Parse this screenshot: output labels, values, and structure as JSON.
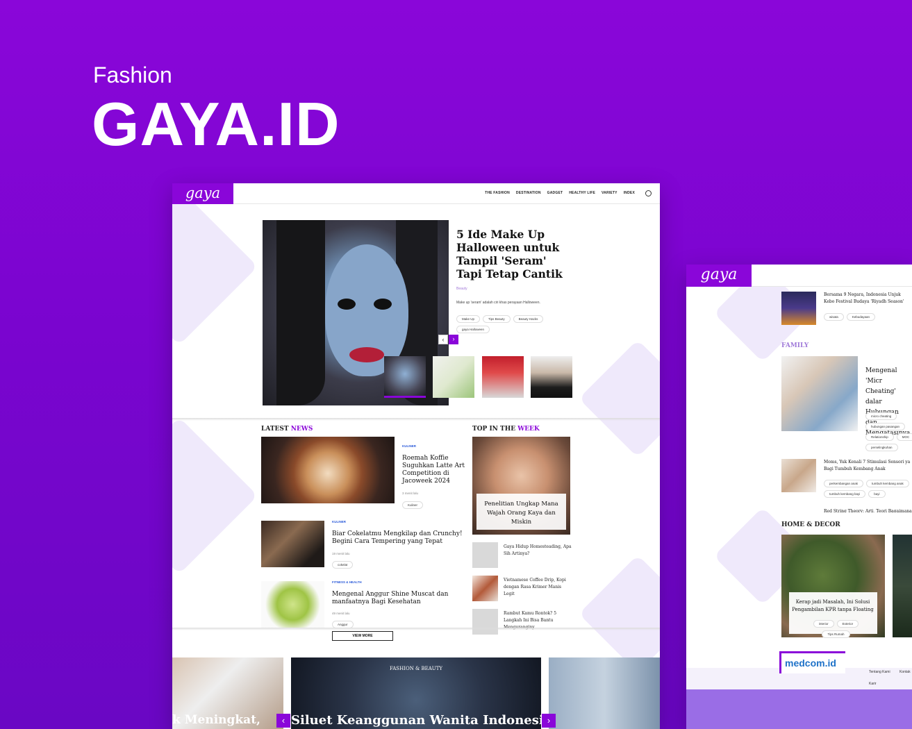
{
  "hero": {
    "category": "Fashion",
    "title": "GAYA.ID"
  },
  "site": {
    "logo": "gaya",
    "nav": [
      "THE FASHION",
      "DESTINATION",
      "GADGET",
      "HEALTHY LIFE",
      "VARIETY",
      "INDEX"
    ]
  },
  "featured": {
    "title": "5 Ide Make Up Halloween untuk Tampil 'Seram' Tapi Tetap Cantik",
    "category": "Beauty",
    "description": "Make up 'seram' adalah ciri khas perayaan Halloween.",
    "tags": [
      "Make Up",
      "Tips Beauty",
      "Beauty Hacks",
      "gaya Halloween"
    ],
    "prev_icon": "‹",
    "next_icon": "›"
  },
  "latest": {
    "heading_a": "LATEST ",
    "heading_b": "NEWS",
    "articles": [
      {
        "category": "KULINER",
        "title": "Roemah Koffie Suguhkan Latte Art Competition di Jacoweek 2024",
        "time": "3 menit lalu",
        "tag": "Kuliner"
      },
      {
        "category": "KULINER",
        "title": "Biar Cokelatmu Mengkilap dan Crunchy! Begini Cara Tempering yang Tepat",
        "time": "19 menit lalu",
        "tag": "cokelat"
      },
      {
        "category": "FITNESS & HEALTH",
        "title": "Mengenal Anggur Shine Muscat dan manfaatnya Bagi Kesehatan",
        "time": "49 menit lalu",
        "tag": "Anggur"
      }
    ],
    "view_more": "VIEW MORE"
  },
  "top_week": {
    "heading_a": "TOP IN THE ",
    "heading_b": "WEEK",
    "main_title": "Penelitian Ungkap Mana Wajah Orang Kaya dan Miskin",
    "items": [
      "Gaya Hidup Homesteading, Apa Sih Artinya?",
      "Vietnamese Coffee Drip, Kopi dengan Rasa Krimer Manis Legit",
      "Rambut Kamu Rontok? 5 Langkah Ini Bisa Bantu Menguranginy"
    ]
  },
  "carousel": {
    "left_text": "k Meningkat,",
    "center_label": "FASHION & BEAUTY",
    "center_title": "Siluet Keanggunan Wanita Indonesia"
  },
  "mock2": {
    "logo": "gaya",
    "top_item": {
      "title": "Bersama 9 Negara, Indonesia Unjuk Kebo Festival Budaya 'Riyadh Season'",
      "tags": [
        "wisata",
        "Kebudayaan"
      ]
    },
    "family_heading": "FAMILY",
    "family_main": {
      "title": "Mengenal 'Micr Cheating' dalar Hubungan dan Mengatasinya",
      "tags": [
        "micro cheating",
        "hubungan pasangan",
        "Relationship",
        "MOC",
        "perselingkuhan"
      ]
    },
    "family_item": {
      "title": "Moms, Yuk Kenali 7 Stimulasi Sensori ya Bagi Tumbuh Kembang Anak",
      "tags": [
        "perkembangan anak",
        "tumbuh kembang anak",
        "tumbuh kembang bayi",
        "bayi"
      ]
    },
    "family_cut": "Red String Theory: Arti, Teori Bagaimana Me",
    "home_heading": "HOME & DECOR",
    "home_main": {
      "title": "Kerap jadi Masalah, Ini Solusi Pengambilan KPR tanpa Floating",
      "tags": [
        "interior",
        "Exterior",
        "Tips Rumah"
      ]
    },
    "footer_logo": "medcom.id",
    "footer_links": [
      "Tentang Kami",
      "Kontak",
      "Karir"
    ]
  },
  "colors": {
    "brand": "#8a06d9",
    "accent_blue": "#2a5ad9",
    "lavender": "#efe9fb"
  }
}
